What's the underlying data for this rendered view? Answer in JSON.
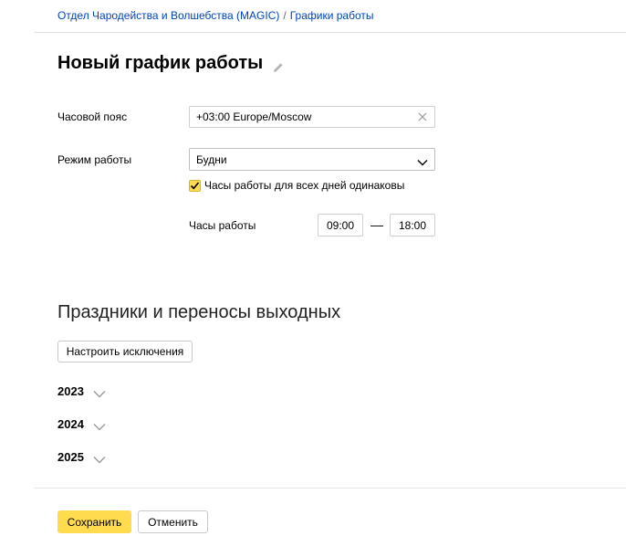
{
  "breadcrumb": {
    "department": "Отдел Чародейства и Волшебства (MAGIC)",
    "separator": "/",
    "current": "Графики работы"
  },
  "page": {
    "title": "Новый график работы",
    "edit_icon": "pencil-icon"
  },
  "form": {
    "timezone_label": "Часовой пояс",
    "timezone_value": "+03:00 Europe/Moscow",
    "mode_label": "Режим работы",
    "mode_value": "Будни",
    "same_hours_checked": true,
    "same_hours_label": "Часы работы для всех дней одинаковы",
    "hours_label": "Часы работы",
    "hours_from": "09:00",
    "hours_dash": "—",
    "hours_to": "18:00"
  },
  "holidays": {
    "title": "Праздники и переносы выходных",
    "configure_button": "Настроить исключения",
    "years": [
      "2023",
      "2024",
      "2025"
    ]
  },
  "footer": {
    "save_label": "Сохранить",
    "cancel_label": "Отменить"
  },
  "colors": {
    "link": "#0044bb",
    "accent": "#ffdb4d"
  }
}
